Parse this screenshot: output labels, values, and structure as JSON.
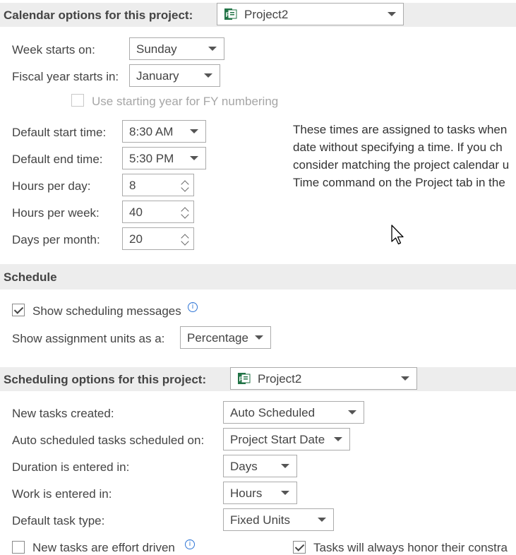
{
  "calendar": {
    "header": "Calendar options for this project:",
    "project_select": "Project2",
    "week_starts_label": "Week starts on:",
    "week_starts_value": "Sunday",
    "fiscal_year_label": "Fiscal year starts in:",
    "fiscal_year_value": "January",
    "fy_numbering_label": "Use starting year for FY numbering",
    "default_start_label": "Default start time:",
    "default_start_value": "8:30 AM",
    "default_end_label": "Default end time:",
    "default_end_value": "5:30 PM",
    "hours_day_label": "Hours per day:",
    "hours_day_value": "8",
    "hours_week_label": "Hours per week:",
    "hours_week_value": "40",
    "days_month_label": "Days per month:",
    "days_month_value": "20",
    "note_lines": [
      "These times are assigned to tasks when",
      "date without specifying a time. If you ch",
      "consider matching the project calendar u",
      "Time command on the Project tab in the"
    ]
  },
  "schedule": {
    "header": "Schedule",
    "show_messages_label": "Show scheduling messages",
    "show_messages_checked": true,
    "assignment_units_label": "Show assignment units as a:",
    "assignment_units_value": "Percentage"
  },
  "scheduling_options": {
    "header": "Scheduling options for this project:",
    "project_select": "Project2",
    "new_tasks_label": "New tasks created:",
    "new_tasks_value": "Auto Scheduled",
    "auto_scheduled_label": "Auto scheduled tasks scheduled on:",
    "auto_scheduled_value": "Project Start Date",
    "duration_label": "Duration is entered in:",
    "duration_value": "Days",
    "work_label": "Work is entered in:",
    "work_value": "Hours",
    "task_type_label": "Default task type:",
    "task_type_value": "Fixed Units",
    "partial_left": "New tasks are effort driven",
    "partial_right": "Tasks will always honor their constra"
  }
}
